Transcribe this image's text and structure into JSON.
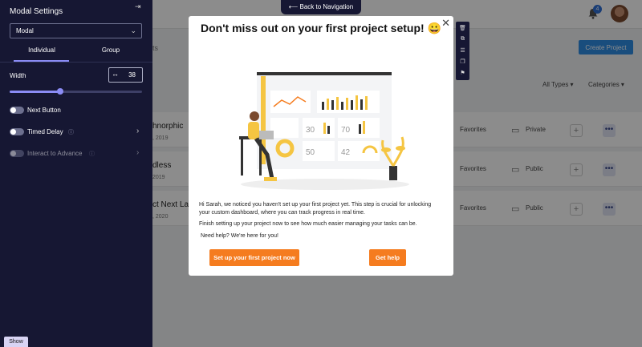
{
  "panel": {
    "title": "Modal Settings",
    "collapse_icon": "collapse-panel-icon",
    "select_value": "Modal",
    "tabs": [
      "Individual",
      "Group"
    ],
    "width_label": "Width",
    "width_value": "38",
    "width_slider_fraction": 0.38,
    "toggles": [
      {
        "label": "Next Button",
        "on": false,
        "disabled": false,
        "info": false,
        "arrow": false
      },
      {
        "label": "Timed Delay",
        "on": false,
        "disabled": false,
        "info": true,
        "arrow": true
      },
      {
        "label": "Interact to Advance",
        "on": false,
        "disabled": true,
        "info": true,
        "arrow": true
      }
    ],
    "show_label": "Show",
    "accent": "#8b8cf5",
    "bg": "#161733"
  },
  "back_nav": {
    "label": "Back to Navigation",
    "icon": "arrow-left-icon"
  },
  "modal": {
    "title": "Don't miss out on your first project setup! 😀",
    "close_icon": "close-icon",
    "paragraph1": "Hi Sarah, we noticed you haven't set up your first project yet. This step is crucial for unlocking your custom dashboard, where you can track progress in real time.",
    "paragraph2": "Finish setting up your project now to see how much easier managing your tasks can be.",
    "paragraph3": "Need help? We're here for you!",
    "primary_cta": "Set up your first project now",
    "secondary_cta": "Get help",
    "cta_color": "#f57c1f",
    "illustration": {
      "numbers": [
        "30",
        "70",
        "50",
        "42"
      ],
      "icon": "dashboard-illustration"
    }
  },
  "toolbar": {
    "icons": [
      "trash-icon",
      "copy-icon",
      "sliders-icon",
      "duplicate-icon",
      "bookmark-icon"
    ]
  },
  "app": {
    "notification_count": "4",
    "create_button": "Create Project",
    "tab_partial": "ts",
    "filters": [
      "All Types",
      "Categories"
    ],
    "rows": [
      {
        "title": "hnorphic",
        "date": ", 2019",
        "favorite": "Favorites",
        "visibility": "Private"
      },
      {
        "title": "dless",
        "date": "2019",
        "favorite": "Favorites",
        "visibility": "Public"
      },
      {
        "title": "ct Next Lanc",
        "date": ", 2020",
        "favorite": "Favorites",
        "visibility": "Public"
      }
    ]
  }
}
